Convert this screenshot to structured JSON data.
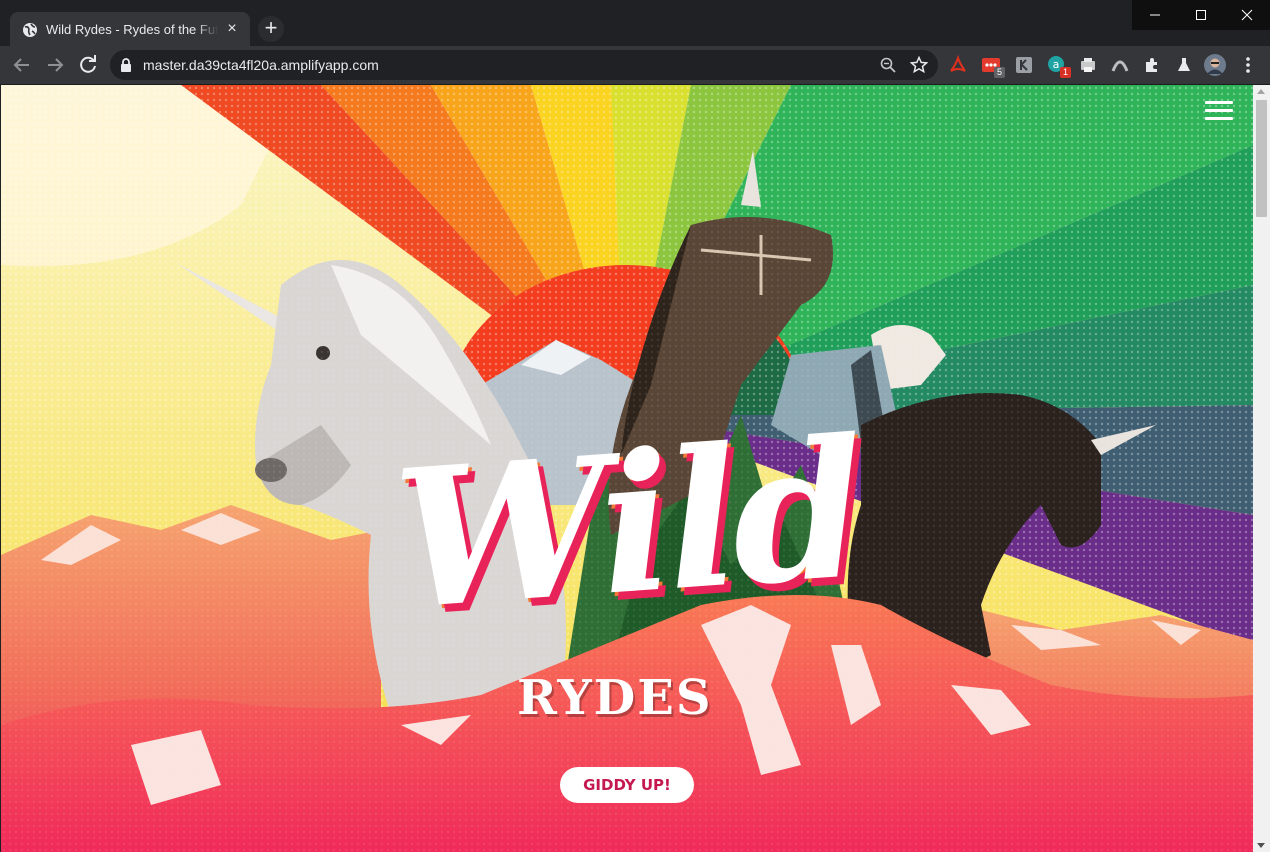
{
  "browser": {
    "tab_title": "Wild Rydes - Rydes of the Future",
    "url": "master.da39cta4fl20a.amplifyapp.com",
    "extensions": [
      {
        "icon": "acrobat-icon",
        "color": "#d4291f"
      },
      {
        "icon": "ellipsis-ext-icon",
        "color": "#e33b2e",
        "badge": "5"
      },
      {
        "icon": "bookmark-ext-icon",
        "color": "#9aa0a6"
      },
      {
        "icon": "at-ext-icon",
        "color": "#1fa3a3",
        "badge": "1"
      },
      {
        "icon": "print-ext-icon",
        "color": "#c9c9c9"
      },
      {
        "icon": "arc-ext-icon",
        "color": "#bdbdbd"
      },
      {
        "icon": "puzzle-icon",
        "color": "#e8eaed"
      },
      {
        "icon": "flask-icon",
        "color": "#e8eaed"
      },
      {
        "icon": "avatar",
        "color": "#6d7b8c"
      }
    ]
  },
  "page": {
    "hero_title": "Wild",
    "hero_subtitle": "RYDES",
    "cta_label": "GIDDY UP!"
  }
}
